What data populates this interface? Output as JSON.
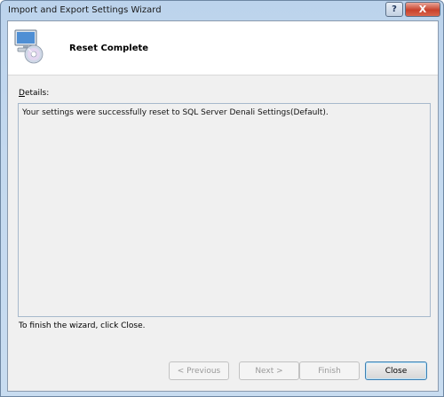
{
  "window": {
    "title": "Import and Export Settings Wizard",
    "help_label": "?",
    "close_label": "X"
  },
  "header": {
    "title": "Reset Complete",
    "icon": "computer-cd-icon"
  },
  "details": {
    "label_accel": "D",
    "label_rest": "etails:",
    "message": "Your settings were successfully reset to SQL Server Denali Settings(Default)."
  },
  "footer": {
    "note": "To finish the wizard, click Close."
  },
  "buttons": {
    "previous": "< Previous",
    "next": "Next >",
    "finish": "Finish",
    "close": "Close"
  },
  "colors": {
    "titlebar": "#c4d9ef",
    "close_button": "#c8422c",
    "client_background": "#f0f0f0"
  }
}
